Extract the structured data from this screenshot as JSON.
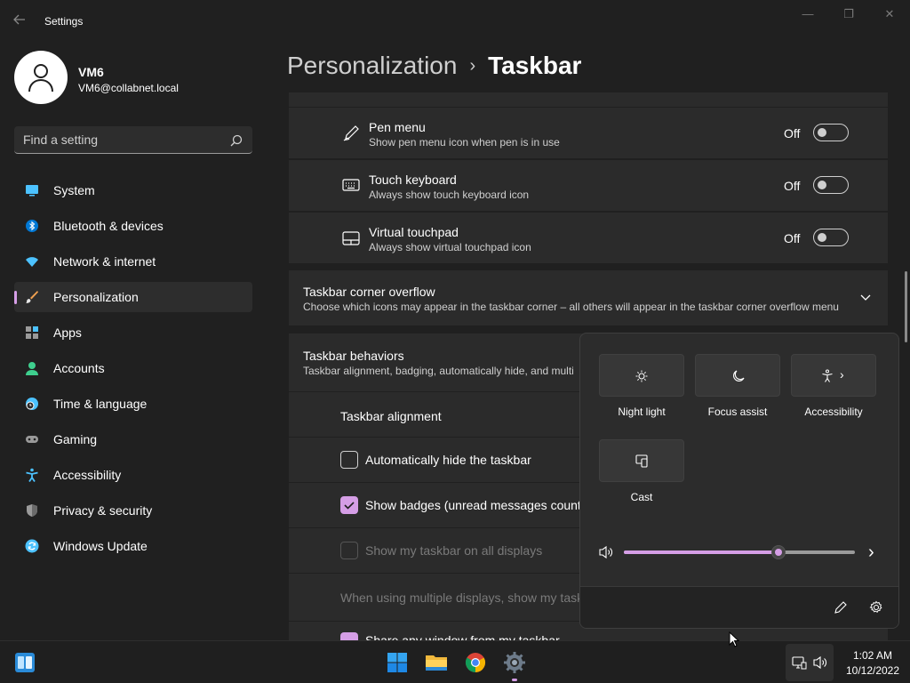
{
  "window": {
    "title": "Settings",
    "controls": {
      "minimize": "—",
      "maximize": "❐",
      "close": "✕"
    },
    "back_icon": "back-arrow-icon"
  },
  "profile": {
    "name": "VM6",
    "email": "VM6@collabnet.local"
  },
  "search": {
    "placeholder": "Find a setting",
    "icon": "search-icon"
  },
  "nav": [
    {
      "label": "System",
      "icon": "monitor-icon",
      "color": "#4cc2ff"
    },
    {
      "label": "Bluetooth & devices",
      "icon": "bluetooth-icon",
      "color": "#0078d4"
    },
    {
      "label": "Network & internet",
      "icon": "wifi-icon",
      "color": "#4cc2ff"
    },
    {
      "label": "Personalization",
      "icon": "brush-icon",
      "color": "#f0a050",
      "active": true
    },
    {
      "label": "Apps",
      "icon": "apps-icon",
      "color": "#9a9a9a"
    },
    {
      "label": "Accounts",
      "icon": "person-icon",
      "color": "#3ecf8e"
    },
    {
      "label": "Time & language",
      "icon": "clock-globe-icon",
      "color": "#4cc2ff"
    },
    {
      "label": "Gaming",
      "icon": "gamepad-icon",
      "color": "#9a9a9a"
    },
    {
      "label": "Accessibility",
      "icon": "accessibility-icon",
      "color": "#4cc2ff"
    },
    {
      "label": "Privacy & security",
      "icon": "shield-icon",
      "color": "#9a9a9a"
    },
    {
      "label": "Windows Update",
      "icon": "update-icon",
      "color": "#4cc2ff"
    }
  ],
  "breadcrumb": {
    "parent": "Personalization",
    "separator": "›",
    "current": "Taskbar"
  },
  "taskbar_icons": [
    {
      "title": "Pen menu",
      "desc": "Show pen menu icon when pen is in use",
      "state": "Off",
      "icon": "pen-icon"
    },
    {
      "title": "Touch keyboard",
      "desc": "Always show touch keyboard icon",
      "state": "Off",
      "icon": "keyboard-icon"
    },
    {
      "title": "Virtual touchpad",
      "desc": "Always show virtual touchpad icon",
      "state": "Off",
      "icon": "touchpad-icon"
    }
  ],
  "corner_overflow": {
    "title": "Taskbar corner overflow",
    "desc": "Choose which icons may appear in the taskbar corner – all others will appear in the taskbar corner overflow menu"
  },
  "behaviors": {
    "title": "Taskbar behaviors",
    "desc": "Taskbar alignment, badging, automatically hide, and multi",
    "alignment_label": "Taskbar alignment",
    "options": [
      {
        "label": "Automatically hide the taskbar",
        "checked": false,
        "disabled": false
      },
      {
        "label": "Show badges (unread messages counte",
        "checked": true,
        "disabled": false
      },
      {
        "label": "Show my taskbar on all displays",
        "checked": false,
        "disabled": true
      }
    ],
    "multi_display_label": "When using multiple displays, show my task",
    "share_window_label": "Share any window from my taskbar"
  },
  "quick_settings": {
    "tiles": [
      {
        "label": "Night light",
        "icon": "brightness-icon"
      },
      {
        "label": "Focus assist",
        "icon": "moon-icon"
      },
      {
        "label": "Accessibility",
        "icon": "accessibility-icon",
        "chevron": "›"
      },
      {
        "label": "Cast",
        "icon": "cast-icon"
      }
    ],
    "volume": {
      "level": 0.67,
      "icon": "speaker-icon",
      "chevron": "›"
    },
    "footer": {
      "edit_icon": "pencil-icon",
      "settings_icon": "gear-icon"
    }
  },
  "taskbar": {
    "apps": [
      "widgets-icon",
      "start-icon",
      "file-explorer-icon",
      "chrome-icon",
      "settings-app-icon"
    ],
    "tray": [
      "network-icon",
      "volume-icon"
    ],
    "time": "1:02 AM",
    "date": "10/12/2022"
  },
  "accent_color": "#d59ee6"
}
